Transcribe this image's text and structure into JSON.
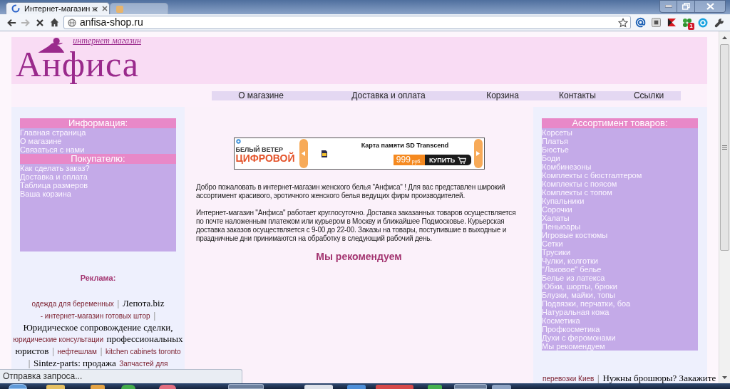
{
  "browser": {
    "tabs": [
      {
        "title": "Интернет-магазин ж",
        "selected": true
      },
      {
        "selected": false
      }
    ],
    "address": "anfisa-shop.ru",
    "extension_badge": "1"
  },
  "header": {
    "logo_subtitle": "интернет магазин",
    "logo_title": "Анфиса"
  },
  "nav": [
    "О магазине",
    "Доставка и оплата",
    "Корзина",
    "Контакты",
    "Ссылки"
  ],
  "left_menu": [
    {
      "heading": "Информация:",
      "items": [
        "Главная страница",
        "О магазине",
        "Связаться с нами"
      ]
    },
    {
      "heading": "Покупателю:",
      "items": [
        "Как сделать заказ?",
        "Доставка и оплата",
        "Таблица размеров",
        "Ваша корзина"
      ]
    }
  ],
  "left_ads": {
    "title": "Реклама:",
    "segments": [
      {
        "kind": "link",
        "text": "одежда для беременных"
      },
      {
        "kind": "separator",
        "text": "|"
      },
      {
        "kind": "text",
        "text": "Лепота.biz"
      },
      {
        "kind": "link",
        "text": "- интернет-магазин готовых штор"
      },
      {
        "kind": "separator",
        "text": "|"
      },
      {
        "kind": "text",
        "text": "Юридическое сопровождение сделки,"
      },
      {
        "kind": "link",
        "text": "юридические консультации"
      },
      {
        "kind": "text",
        "text": "профессиональных юристов"
      },
      {
        "kind": "separator",
        "text": "|"
      },
      {
        "kind": "link",
        "text": "нефтешлам"
      },
      {
        "kind": "separator",
        "text": "|"
      },
      {
        "kind": "link",
        "text": "kitchen cabinets toronto"
      },
      {
        "kind": "separator",
        "text": "|"
      },
      {
        "kind": "text",
        "text": "Sintez-parts: продажа"
      },
      {
        "kind": "link",
        "text": "Запчастей для"
      }
    ]
  },
  "banner": {
    "brand_line_1": "БЕЛЫЙ ВЕТЕР",
    "brand_line_2": "ЦИФРОВОЙ",
    "product": "Карта памяти SD Transcend",
    "price": "999",
    "currency": "руб.",
    "buy_label": "КУПИТЬ"
  },
  "intro": [
    "Добро пожаловать в интернет-магазин женского белья \"Анфиса\" ! Для вас представлен широкий ассортимент красивого, эротичного женского белья ведущих фирм производителей.",
    "Интернет-магазин \"Анфиса\" работает круглосуточно. Доставка заказанных товаров осуществляется по почте наложенным платежом или курьером в Москву и ближайшее Подмосковье. Курьерская доставка заказов осуществляется с 9-00 до 22-00. Заказы на товары, поступившие в выходные и праздничные дни принимаются на обработку в следующий рабочий день."
  ],
  "recommend_heading": "Мы рекомендуем",
  "right_menu": {
    "heading": "Ассортимент товаров:",
    "items": [
      "Корсеты",
      "Платья",
      "Бюстье",
      "Боди",
      "Комбинезоны",
      "Комплекты с бюстгалтером",
      "Комплекты с поясом",
      "Комплекты с топом",
      "Купальники",
      "Сорочки",
      "Халаты",
      "Пеньюары",
      "Игровые костюмы",
      "Сетки",
      "Трусики",
      "Чулки, колготки",
      "\"Лаковое\" белье",
      "Белье из латекса",
      "Юбки, шорты, брюки",
      "Блузки, майки, топы",
      "Подвязки, перчатки, боа",
      "Натуральная кожа",
      "Косметика",
      "Профкосметика",
      "Духи с феромонами",
      "Мы рекомендуем"
    ]
  },
  "right_ads": {
    "segments": [
      {
        "kind": "link",
        "text": "перевозки Киев"
      },
      {
        "kind": "separator",
        "text": "|"
      },
      {
        "kind": "text",
        "text": "Нужны брошюры? Закажите"
      }
    ]
  },
  "status_bar": "Отправка запроса..."
}
